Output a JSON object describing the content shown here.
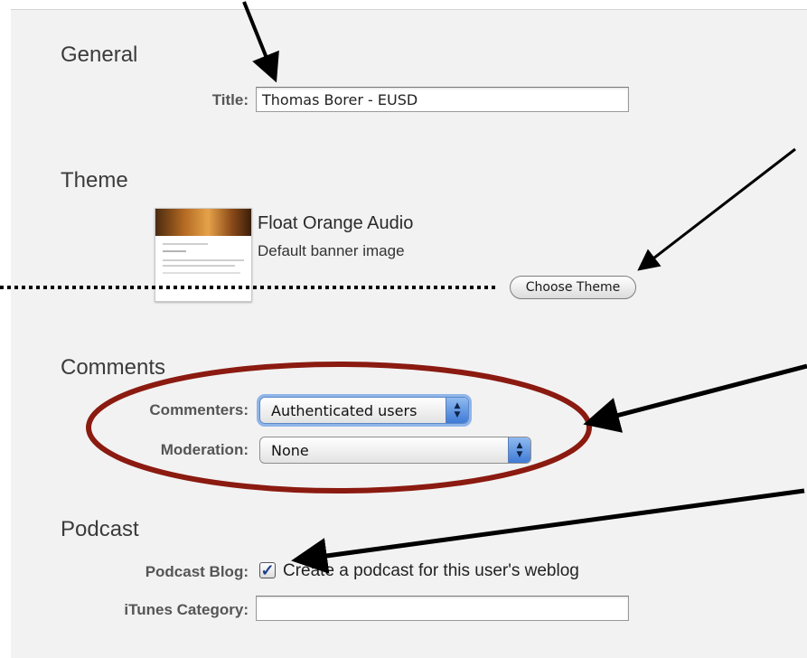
{
  "general": {
    "heading": "General",
    "title_label": "Title:",
    "title_value": "Thomas Borer - EUSD"
  },
  "theme": {
    "heading": "Theme",
    "name": "Float Orange Audio",
    "banner": "Default banner image",
    "choose_button": "Choose Theme"
  },
  "comments": {
    "heading": "Comments",
    "commenters_label": "Commenters:",
    "commenters_value": "Authenticated users",
    "moderation_label": "Moderation:",
    "moderation_value": "None"
  },
  "podcast": {
    "heading": "Podcast",
    "podcast_blog_label": "Podcast Blog:",
    "podcast_blog_checked": true,
    "podcast_blog_text": "Create a podcast for this user's weblog",
    "itunes_label": "iTunes Category:",
    "itunes_value": ""
  },
  "icons": {
    "stepper": "stepper-arrows-icon",
    "check": "checkmark-icon"
  },
  "colors": {
    "annotation_ellipse": "#8b1a10",
    "annotation_arrow": "#000000",
    "focus_ring": "#6ea0e6",
    "stepper_blue": "#3f7ad6"
  }
}
